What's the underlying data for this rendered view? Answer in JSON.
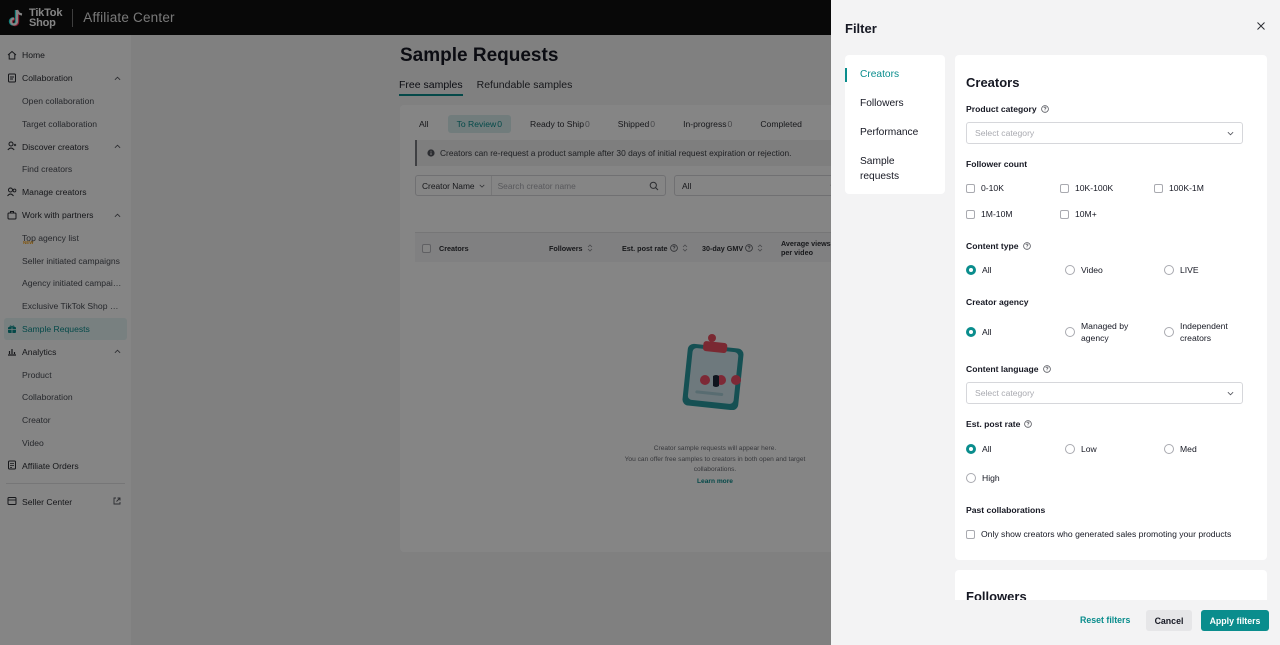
{
  "header": {
    "logo_line1": "TikTok",
    "logo_line2": "Shop",
    "app_title": "Affiliate Center"
  },
  "sidebar": {
    "items": [
      {
        "label": "Home",
        "icon": "home-icon"
      },
      {
        "label": "Collaboration",
        "icon": "collaboration-icon"
      },
      {
        "label": "Open collaboration"
      },
      {
        "label": "Target collaboration"
      },
      {
        "label": "Discover creators",
        "icon": "discover-icon"
      },
      {
        "label": "Find creators"
      },
      {
        "label": "Manage creators",
        "icon": "manage-creators-icon"
      },
      {
        "label": "Work with partners",
        "icon": "partners-icon"
      },
      {
        "label": "Top agency list",
        "badge": "NEW"
      },
      {
        "label": "Seller initiated campaigns"
      },
      {
        "label": "Agency initiated campaigns"
      },
      {
        "label": "Exclusive TikTok Shop creators"
      },
      {
        "label": "Sample Requests",
        "icon": "sample-requests-icon"
      },
      {
        "label": "Analytics",
        "icon": "analytics-icon"
      },
      {
        "label": "Product"
      },
      {
        "label": "Collaboration"
      },
      {
        "label": "Creator"
      },
      {
        "label": "Video"
      },
      {
        "label": "Affiliate Orders",
        "icon": "orders-icon"
      },
      {
        "label": "Seller Center",
        "icon": "seller-center-icon"
      }
    ]
  },
  "main": {
    "title": "Sample Requests",
    "tabs": [
      "Free samples",
      "Refundable samples"
    ],
    "status_tabs": [
      {
        "label": "All",
        "count": ""
      },
      {
        "label": "To Review",
        "count": "0"
      },
      {
        "label": "Ready to Ship",
        "count": "0"
      },
      {
        "label": "Shipped",
        "count": "0"
      },
      {
        "label": "In-progress",
        "count": "0"
      },
      {
        "label": "Completed",
        "count": ""
      }
    ],
    "info_text": "Creators can re-request a product sample after 30 days of initial request expiration or rejection.",
    "search": {
      "type_label": "Creator Name",
      "placeholder": "Search creator name",
      "all_label": "All"
    },
    "table_headers": [
      "Creators",
      "Followers",
      "Est. post rate",
      "30-day GMV",
      "Average views",
      "per video"
    ],
    "empty_line1": "Creator sample requests will appear here.",
    "empty_line2": "You can offer free samples to creators in both open and target collaborations.",
    "learn_more": "Learn more"
  },
  "filter": {
    "title": "Filter",
    "nav": [
      "Creators",
      "Followers",
      "Performance",
      "Sample",
      "requests"
    ],
    "panel_title": "Creators",
    "product_category": {
      "label": "Product category",
      "placeholder": "Select category"
    },
    "follower_count": {
      "label": "Follower count",
      "options": [
        "0-10K",
        "10K-100K",
        "100K-1M",
        "1M-10M",
        "10M+"
      ]
    },
    "content_type": {
      "label": "Content type",
      "options": [
        "All",
        "Video",
        "LIVE"
      ],
      "selected": "All"
    },
    "creator_agency": {
      "label": "Creator agency",
      "options": [
        "All",
        "Managed by",
        "agency",
        "Independent",
        "creators"
      ],
      "selected": "All"
    },
    "content_language": {
      "label": "Content language",
      "placeholder": "Select category"
    },
    "est_post_rate": {
      "label": "Est. post rate",
      "options": [
        "All",
        "Low",
        "Med",
        "High"
      ],
      "selected": "All"
    },
    "past_collaborations": {
      "label": "Past collaborations",
      "option": "Only show creators who generated sales promoting your products"
    },
    "next_section_title": "Followers",
    "reset_label": "Reset filters",
    "cancel_label": "Cancel",
    "apply_label": "Apply filters"
  },
  "colors": {
    "accent": "#0a8d8d",
    "topbar": "#111111",
    "overlay": "rgba(0,0,0,0.48)"
  }
}
